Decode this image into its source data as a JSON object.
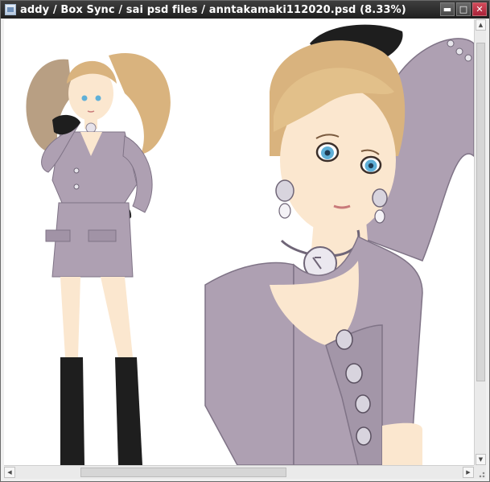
{
  "window": {
    "title": "addy / Box Sync / sai psd files / anntakamaki112020.psd (8.33%)",
    "buttons": {
      "minimize": "▬",
      "maximize": "□",
      "close": "✕"
    },
    "icon": "document-window-icon"
  },
  "scrollbars": {
    "vertical": {
      "up_icon": "▲",
      "down_icon": "▼",
      "position": 0.14,
      "visible_fraction": 0.8
    },
    "horizontal": {
      "left_icon": "◀",
      "right_icon": "▶",
      "position": 0.27,
      "visible_fraction": 0.46
    }
  },
  "colors": {
    "titlebar": "#2a2a2a",
    "close_button": "#c0344a",
    "hair": "#d9b37e",
    "skin": "#fbe7cf",
    "suit": "#aea0b2",
    "glove": "#1e1e1e",
    "eyes": "#5fb0d8"
  }
}
